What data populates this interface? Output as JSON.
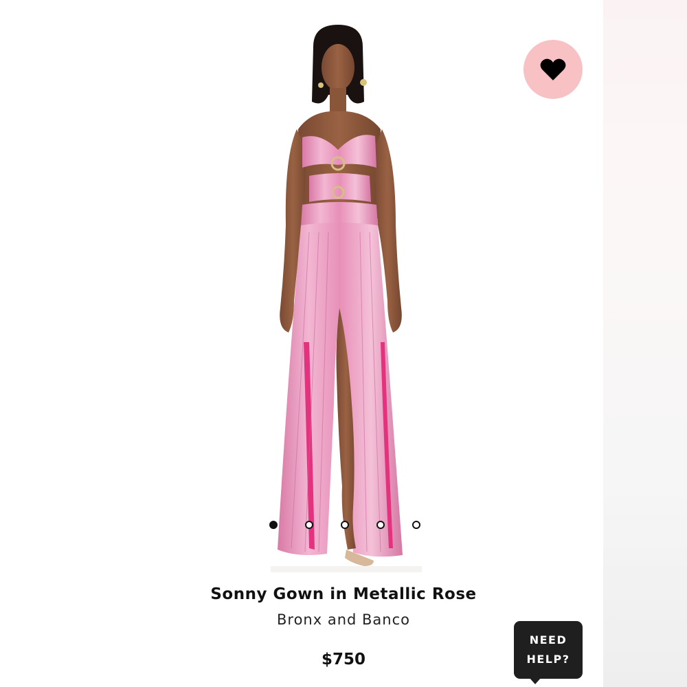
{
  "product": {
    "title": "Sonny Gown in Metallic Rose",
    "brand": "Bronx and Banco",
    "price": "$750",
    "image_alt": "Model wearing a metallic rose strapless cut-out gown",
    "image_count": 5,
    "active_image": 1
  },
  "favorite": {
    "icon": "heart-icon",
    "state": "selected"
  },
  "help_button": {
    "line1": "NEED",
    "line2": "HELP?"
  },
  "colors": {
    "favorite_bg": "#f8c2c5",
    "dress": "#e58fb6",
    "help_bg": "#1f1f1f"
  }
}
